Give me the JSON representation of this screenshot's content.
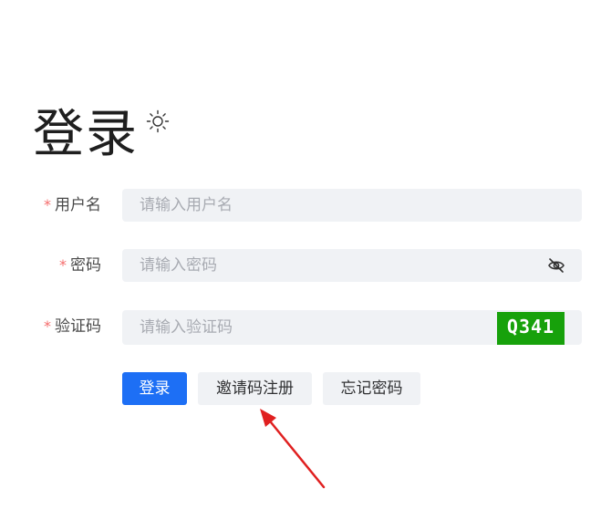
{
  "title": "登录",
  "theme_icon": "sun-icon",
  "form": {
    "username": {
      "label": "用户名",
      "placeholder": "请输入用户名",
      "required": true
    },
    "password": {
      "label": "密码",
      "placeholder": "请输入密码",
      "required": true,
      "toggle_icon": "eye-off-icon"
    },
    "captcha": {
      "label": "验证码",
      "placeholder": "请输入验证码",
      "required": true,
      "image_text": "Q341"
    }
  },
  "buttons": {
    "login": "登录",
    "invite_register": "邀请码注册",
    "forgot_password": "忘记密码"
  },
  "required_marker": "*",
  "colors": {
    "primary": "#1d6ff5",
    "required": "#f56c6c",
    "captcha_bg": "#17a10b",
    "arrow": "#e02020"
  }
}
